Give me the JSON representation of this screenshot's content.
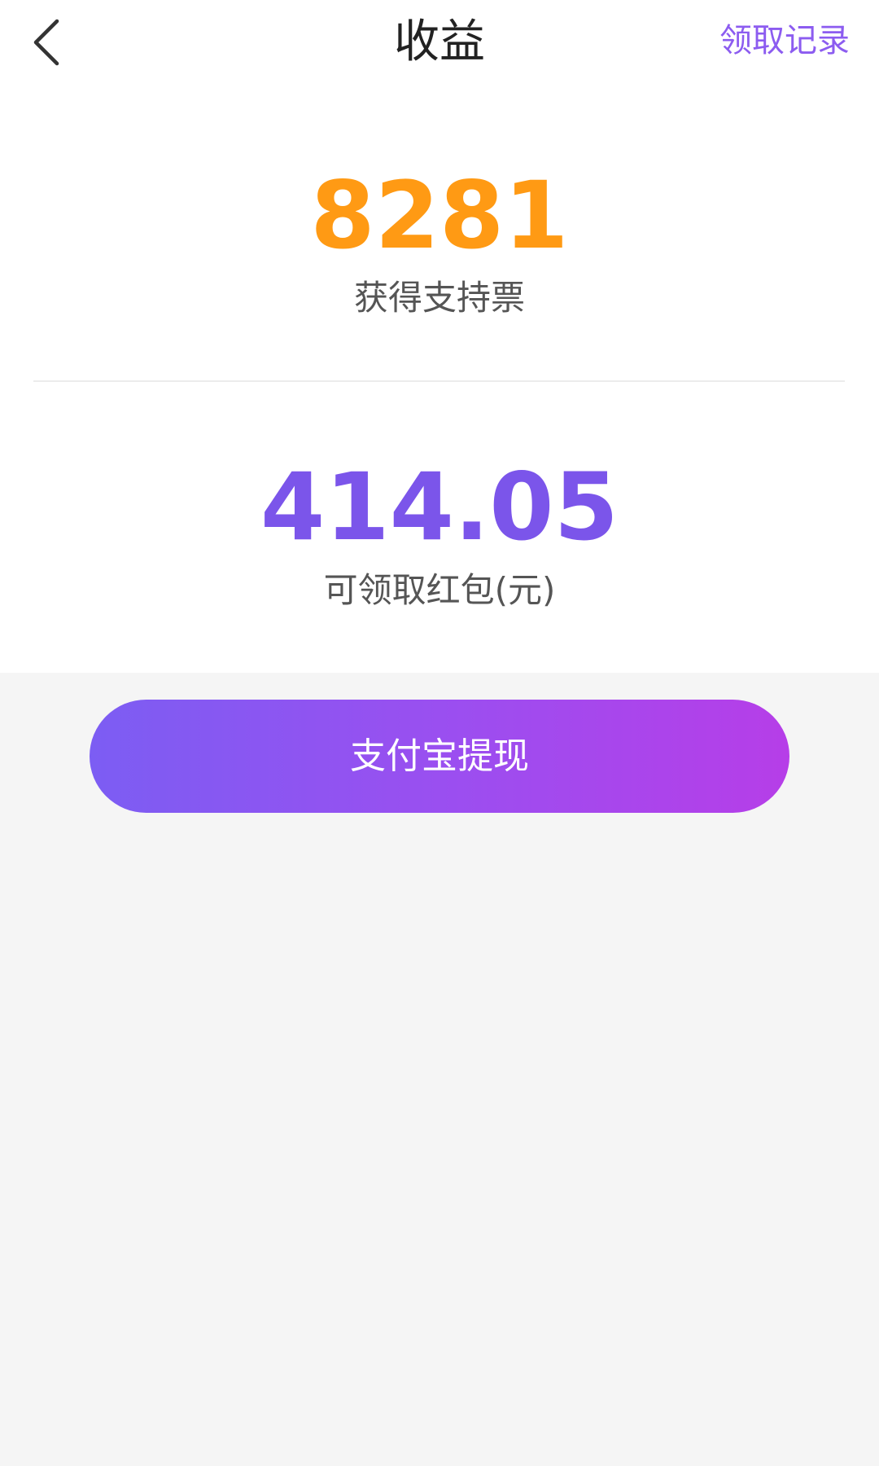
{
  "header": {
    "back_icon": "chevron-left-icon",
    "title": "收益",
    "record_link": "领取记录"
  },
  "votes": {
    "value": "8281",
    "label": "获得支持票"
  },
  "red_packet": {
    "value": "414.05",
    "label": "可领取红包(元)"
  },
  "actions": {
    "withdraw_label": "支付宝提现"
  },
  "colors": {
    "accent_purple": "#8c5cf0",
    "votes_orange": "#ff9a14",
    "amount_purple": "#7b55ea",
    "button_gradient_start": "#7c5df3",
    "button_gradient_end": "#b63ee8"
  }
}
